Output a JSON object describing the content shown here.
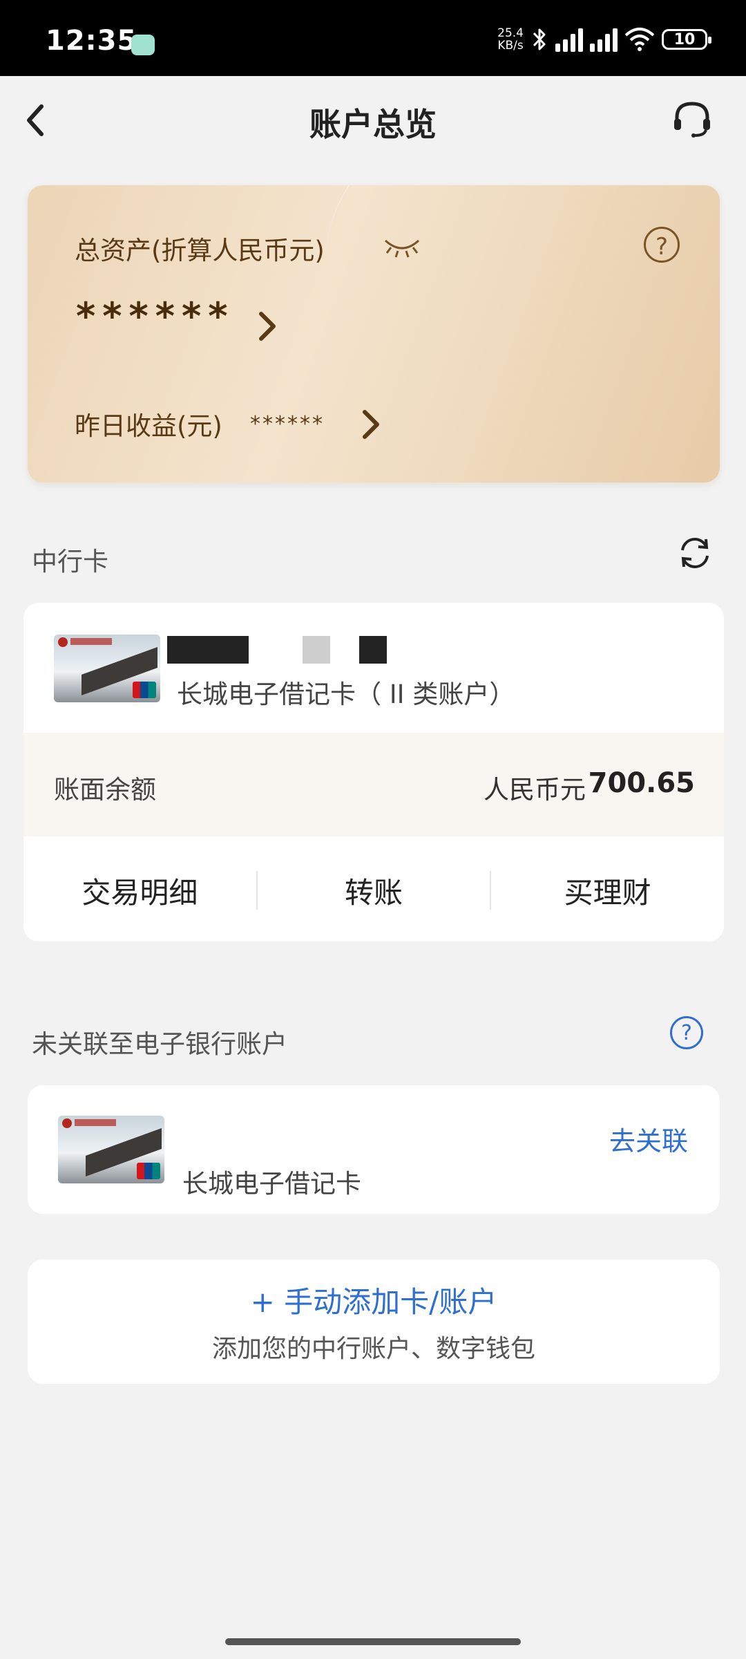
{
  "status_bar": {
    "time": "12:35",
    "net_speed_value": "25.4",
    "net_speed_unit": "KB/s",
    "battery": "10"
  },
  "nav": {
    "title": "账户总览",
    "back_icon": "chevron-left-icon",
    "service_icon": "headset-icon"
  },
  "asset_card": {
    "label": "总资产(折算人民币元)",
    "value": "******",
    "yield_label": "昨日收益(元)",
    "yield_value": "******",
    "help": "?",
    "colors": {
      "card_gradient_start": "#ecd5b7",
      "card_gradient_end": "#e7cba7",
      "text": "#5a3a14"
    }
  },
  "boc_section": {
    "title": "中行卡",
    "card": {
      "name": "长城电子借记卡（ II 类账户）",
      "balance_label": "账面余额",
      "currency": "人民币元",
      "amount": "700.65",
      "actions": [
        "交易明细",
        "转账",
        "买理财"
      ]
    }
  },
  "unlinked_section": {
    "title": "未关联至电子银行账户",
    "help": "?",
    "card": {
      "name": "长城电子借记卡",
      "link_label": "去关联"
    }
  },
  "add_card": {
    "title": "+ 手动添加卡/账户",
    "subtitle": "添加您的中行账户、数字钱包"
  },
  "accent_color": "#2f6fd0"
}
